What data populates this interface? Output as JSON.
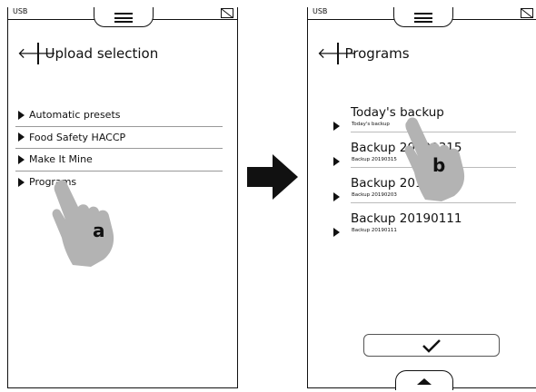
{
  "status": {
    "usb_label": "USB"
  },
  "left_screen": {
    "title": "Upload selection",
    "menu_items": [
      {
        "label": "Automatic presets"
      },
      {
        "label": "Food Safety HACCP"
      },
      {
        "label": "Make It Mine"
      },
      {
        "label": "Programs"
      }
    ]
  },
  "right_screen": {
    "title": "Programs",
    "programs": [
      {
        "name": "Today's backup",
        "sub": "Today's backup"
      },
      {
        "name": "Backup 20190315",
        "sub": "Backup 20190315"
      },
      {
        "name": "Backup 20190203",
        "sub": "Backup 20190203"
      },
      {
        "name": "Backup 20190111",
        "sub": "Backup 20190111"
      }
    ]
  },
  "annotations": {
    "step_a": "a",
    "step_b": "b"
  },
  "icons": [
    "menu-icon",
    "back-arrow-icon",
    "triangle-icon",
    "checkmark-icon",
    "up-arrow-icon",
    "usb-status-icon",
    "hand-pointer-icon",
    "right-arrow-icon"
  ],
  "colors": {
    "line": "#111111",
    "hand": "#b3b3b3",
    "divider": "#999999"
  }
}
